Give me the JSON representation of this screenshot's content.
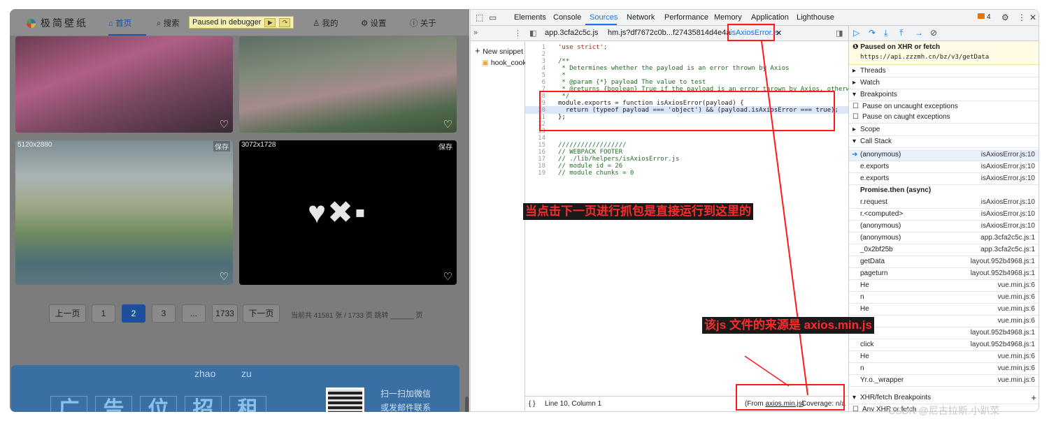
{
  "site": {
    "logo_text": "极简壁纸",
    "nav": {
      "home": "首页",
      "search": "搜索",
      "mine": "我的",
      "settings": "设置",
      "about": "关于"
    },
    "debugger_badge": "Paused in debugger",
    "cards": [
      {
        "resolution": "",
        "save": ""
      },
      {
        "resolution": "",
        "save": ""
      },
      {
        "resolution": "5120x2880",
        "save": "保存"
      },
      {
        "resolution": "3072x1728",
        "save": "保存"
      }
    ],
    "pagination": {
      "prev": "上一页",
      "p1": "1",
      "p2": "2",
      "p3": "3",
      "ellipsis": "...",
      "last": "1733",
      "next": "下一页",
      "info": "当前共 41581 张 / 1733 页 跳转 ______ 页"
    },
    "ad": {
      "chars": [
        "广",
        "告",
        "位",
        "招",
        "租"
      ],
      "pinyin_zhao": "zhao",
      "pinyin_zu": "zu",
      "line1": "扫一扫加微信",
      "line2": "或发邮件联系"
    }
  },
  "devtools": {
    "main_tabs": [
      "Elements",
      "Console",
      "Sources",
      "Network",
      "Performance",
      "Memory",
      "Application",
      "Lighthouse"
    ],
    "issues_count": "4",
    "file_tabs": [
      "app.3cfa2c5c.js",
      "hm.js?df7672c0b...f27435814d4e4a",
      "isAxiosError.js"
    ],
    "navigator": {
      "new_snippet": "New snippet",
      "snippet_file": "hook_cook"
    },
    "code_lines": [
      {
        "n": "1",
        "t": "'use strict';",
        "c": "str"
      },
      {
        "n": "2",
        "t": "",
        "c": ""
      },
      {
        "n": "3",
        "t": "/**",
        "c": "cm"
      },
      {
        "n": "4",
        "t": " * Determines whether the payload is an error thrown by Axios",
        "c": "cm"
      },
      {
        "n": "5",
        "t": " *",
        "c": "cm"
      },
      {
        "n": "6",
        "t": " * @param {*} payload The value to test",
        "c": "cm"
      },
      {
        "n": "7",
        "t": " * @returns {boolean} True if the payload is an error thrown by Axios, otherwise",
        "c": "cm"
      },
      {
        "n": "8",
        "t": " */",
        "c": "cm"
      },
      {
        "n": "9",
        "t": "module.exports = function isAxiosError(payload) {",
        "c": ""
      },
      {
        "n": "10",
        "t": "  return (typeof payload === 'object') && (payload.isAxiosError === true);",
        "c": ""
      },
      {
        "n": "11",
        "t": "};",
        "c": ""
      },
      {
        "n": "12",
        "t": "",
        "c": ""
      },
      {
        "n": "13",
        "t": "",
        "c": ""
      },
      {
        "n": "14",
        "t": "",
        "c": ""
      },
      {
        "n": "15",
        "t": "//////////////////",
        "c": "cm"
      },
      {
        "n": "16",
        "t": "// WEBPACK FOOTER",
        "c": "cm"
      },
      {
        "n": "17",
        "t": "// ./lib/helpers/isAxiosError.js",
        "c": "cm"
      },
      {
        "n": "18",
        "t": "// module id = 26",
        "c": "cm"
      },
      {
        "n": "19",
        "t": "// module chunks = 0",
        "c": "cm"
      }
    ],
    "status": {
      "position": "Line 10, Column 1",
      "from_label": "(From ",
      "from_file": "axios.min.js",
      "from_end": ")",
      "coverage": "Coverage: n/a"
    },
    "debugger": {
      "paused_title": "Paused on XHR or fetch",
      "paused_url": "https://api.zzzmh.cn/bz/v3/getData",
      "threads": "Threads",
      "watch": "Watch",
      "breakpoints": "Breakpoints",
      "pause_uncaught": "Pause on uncaught exceptions",
      "pause_caught": "Pause on caught exceptions",
      "scope": "Scope",
      "call_stack": "Call Stack",
      "async_label": "Promise.then (async)",
      "frames_sync": [
        {
          "fn": "(anonymous)",
          "loc": "isAxiosError.js:10"
        },
        {
          "fn": "e.exports",
          "loc": "isAxiosError.js:10"
        },
        {
          "fn": "e.exports",
          "loc": "isAxiosError.js:10"
        }
      ],
      "frames_async": [
        {
          "fn": "r.request",
          "loc": "isAxiosError.js:10"
        },
        {
          "fn": "r.<computed>",
          "loc": "isAxiosError.js:10"
        },
        {
          "fn": "(anonymous)",
          "loc": "isAxiosError.js:10"
        },
        {
          "fn": "(anonymous)",
          "loc": "app.3cfa2c5c.js:1"
        },
        {
          "fn": "_0x2bf25b",
          "loc": "app.3cfa2c5c.js:1"
        },
        {
          "fn": "getData",
          "loc": "layout.952b4968.js:1"
        },
        {
          "fn": "pageturn",
          "loc": "layout.952b4968.js:1"
        },
        {
          "fn": "He",
          "loc": "vue.min.js:6"
        },
        {
          "fn": "n",
          "loc": "vue.min.js:6"
        },
        {
          "fn": "He",
          "loc": "vue.min.js:6"
        },
        {
          "fn": "",
          "loc": "vue.min.js:6"
        },
        {
          "fn": "",
          "loc": "layout.952b4968.js:1"
        },
        {
          "fn": "click",
          "loc": "layout.952b4968.js:1"
        },
        {
          "fn": "He",
          "loc": "vue.min.js:6"
        },
        {
          "fn": "n",
          "loc": "vue.min.js:6"
        },
        {
          "fn": "Yr.o._wrapper",
          "loc": "vue.min.js:6"
        }
      ],
      "xhr_bp": "XHR/fetch Breakpoints",
      "any_xhr": "Any XHR or fetch"
    }
  },
  "annotations": {
    "run_here": "当点击下一页进行抓包是直接运行到这里的",
    "source": "该js 文件的来源是 axios.min.js"
  },
  "watermark": "CSDN @尼古拉斯.小趴菜",
  "colors": {
    "accent": "#1a73e8",
    "annotation_red": "#ff1a1a",
    "site_blue": "#1d4f9b"
  }
}
